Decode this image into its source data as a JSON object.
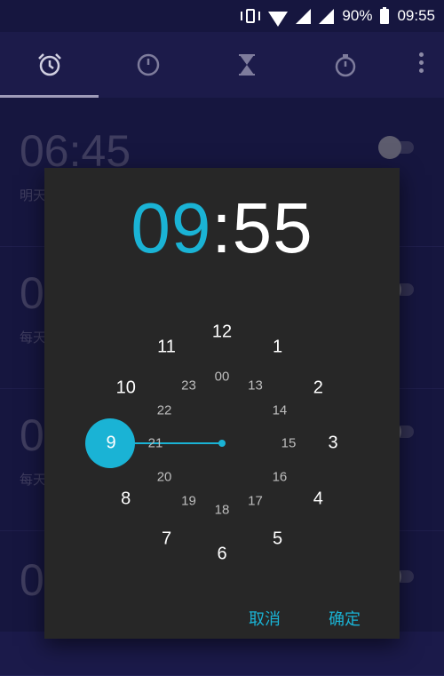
{
  "status_bar": {
    "battery_percent": "90%",
    "clock": "09:55",
    "icons": [
      "vibrate-icon",
      "wifi-icon",
      "signal-icon",
      "signal-icon",
      "battery-icon"
    ]
  },
  "tabs": [
    {
      "name": "alarm-tab-icon",
      "selected": true
    },
    {
      "name": "clock-tab-icon",
      "selected": false
    },
    {
      "name": "timer-tab-icon",
      "selected": false
    },
    {
      "name": "stopwatch-tab-icon",
      "selected": false
    }
  ],
  "background_alarms": [
    {
      "time": "06:45",
      "subtitle": "明天"
    },
    {
      "time": "0",
      "subtitle": "每天"
    },
    {
      "time": "0",
      "subtitle": "每天"
    },
    {
      "time": "0",
      "subtitle": ""
    }
  ],
  "time_picker": {
    "hour": "09",
    "separator": ":",
    "minute": "55",
    "selected_hour": "9",
    "outer_hours": [
      "12",
      "1",
      "2",
      "3",
      "4",
      "5",
      "6",
      "7",
      "8",
      "9",
      "10",
      "11"
    ],
    "inner_hours": [
      "00",
      "13",
      "14",
      "15",
      "16",
      "17",
      "18",
      "19",
      "20",
      "21",
      "22",
      "23"
    ],
    "cancel_label": "取消",
    "ok_label": "确定",
    "accent_color": "#1ab3d5"
  }
}
